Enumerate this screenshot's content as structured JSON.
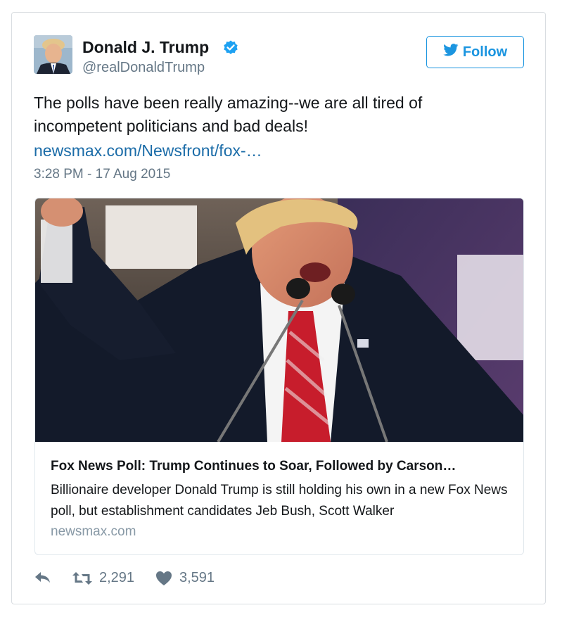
{
  "author": {
    "name": "Donald J. Trump",
    "handle": "@realDonaldTrump",
    "verified_icon": "verified-badge-icon"
  },
  "follow_button": {
    "label": "Follow",
    "icon": "twitter-bird-icon",
    "color": "#1b95e0"
  },
  "tweet": {
    "text": "The polls have been really amazing--we are all tired of incompetent politicians and bad deals!",
    "link": "newsmax.com/Newsfront/fox-…",
    "timestamp": "3:28 PM - 17 Aug 2015"
  },
  "card": {
    "title": "Fox News Poll: Trump Continues to Soar, Followed by Carson…",
    "description": "Billionaire developer Donald Trump is still holding his own in a new Fox News poll, but establishment candidates Jeb Bush, Scott Walker",
    "domain": "newsmax.com"
  },
  "actions": {
    "reply_icon": "reply-icon",
    "retweet_icon": "retweet-icon",
    "retweets": "2,291",
    "like_icon": "heart-icon",
    "likes": "3,591"
  }
}
